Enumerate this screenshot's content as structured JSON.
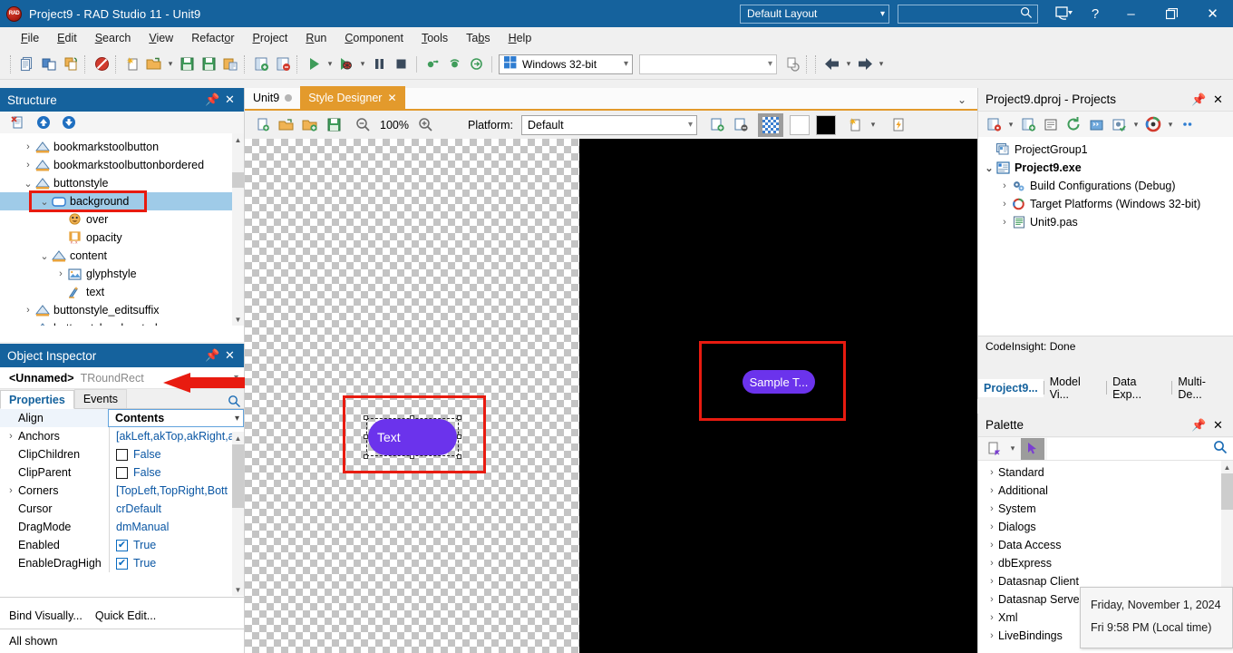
{
  "titlebar": {
    "logo": "rad-logo",
    "title": "Project9 - RAD Studio 11 - Unit9",
    "layout_value": "Default Layout",
    "search_value": "",
    "search_placeholder": "",
    "desktop_icon": "desktop-save-icon",
    "help_label": "?",
    "minimize_label": "–",
    "restore_label": "❐",
    "close_label": "✕",
    "bg_color": "#15629d"
  },
  "menubar": {
    "items": [
      {
        "pre": "",
        "accel": "F",
        "post": "ile"
      },
      {
        "pre": "",
        "accel": "E",
        "post": "dit"
      },
      {
        "pre": "",
        "accel": "S",
        "post": "earch"
      },
      {
        "pre": "",
        "accel": "V",
        "post": "iew"
      },
      {
        "pre": "Refact",
        "accel": "o",
        "post": "r"
      },
      {
        "pre": "",
        "accel": "P",
        "post": "roject"
      },
      {
        "pre": "",
        "accel": "R",
        "post": "un"
      },
      {
        "pre": "",
        "accel": "C",
        "post": "omponent"
      },
      {
        "pre": "",
        "accel": "T",
        "post": "ools"
      },
      {
        "pre": "Ta",
        "accel": "b",
        "post": "s"
      },
      {
        "pre": "",
        "accel": "H",
        "post": "elp"
      }
    ]
  },
  "toolbar": {
    "platform_value": "Windows 32-bit",
    "platform_icon": "windows-icon",
    "combo_value": "",
    "icons": [
      "new-file-icon",
      "copy-window-icon",
      "save-all-copy-icon",
      "no-entry-icon",
      "new-item-icon",
      "open-folder-icon",
      "save-icon",
      "save-as-icon",
      "save-project-icon",
      "add-file-icon",
      "remove-file-icon",
      "run-icon",
      "run-debug-icon",
      "pause-icon",
      "stop-icon",
      "trace-into-icon",
      "step-over-icon",
      "run-to-cursor-icon",
      "refresh-doc-icon",
      "nav-back-icon",
      "nav-forward-icon"
    ]
  },
  "structure": {
    "title": "Structure",
    "pin_icon": "pin-icon",
    "close_icon": "close-icon",
    "toolbar_icons": [
      "delete-node-icon",
      "move-up-icon",
      "move-down-icon"
    ],
    "tree": [
      {
        "label": "bookmarkstoolbutton",
        "indent": 1,
        "arrow": "›",
        "icon": "style-icon",
        "selected": false
      },
      {
        "label": "bookmarkstoolbuttonbordered",
        "indent": 1,
        "arrow": "›",
        "icon": "style-icon",
        "selected": false
      },
      {
        "label": "buttonstyle",
        "indent": 1,
        "arrow": "⌄",
        "icon": "style-icon",
        "selected": false
      },
      {
        "label": "background",
        "indent": 2,
        "arrow": "⌄",
        "icon": "roundrect-icon",
        "selected": true
      },
      {
        "label": "over",
        "indent": 3,
        "arrow": "",
        "icon": "brush-icon",
        "selected": false
      },
      {
        "label": "opacity",
        "indent": 3,
        "arrow": "",
        "icon": "animation-icon",
        "selected": false
      },
      {
        "label": "content",
        "indent": 2,
        "arrow": "⌄",
        "icon": "style-icon",
        "selected": false
      },
      {
        "label": "glyphstyle",
        "indent": 3,
        "arrow": "›",
        "icon": "image-icon",
        "selected": false
      },
      {
        "label": "text",
        "indent": 3,
        "arrow": "",
        "icon": "text-icon",
        "selected": false
      },
      {
        "label": "buttonstyle_editsuffix",
        "indent": 1,
        "arrow": "›",
        "icon": "style-icon",
        "selected": false
      },
      {
        "label": "buttonstyle_elevated",
        "indent": 1,
        "arrow": "›",
        "icon": "style-icon",
        "selected": false
      }
    ]
  },
  "object_inspector": {
    "title": "Object Inspector",
    "pin_icon": "pin-icon",
    "close_icon": "close-icon",
    "selected_name": "<Unnamed>",
    "selected_class": "TRoundRect",
    "tab_properties": "Properties",
    "tab_events": "Events",
    "search_icon": "search-icon",
    "filter_value": "",
    "rows": [
      {
        "name": "Align",
        "value": "Contents",
        "kind": "dropdown",
        "expandable": false
      },
      {
        "name": "Anchors",
        "value": "[akLeft,akTop,akRight,a",
        "kind": "text",
        "expandable": true
      },
      {
        "name": "ClipChildren",
        "value": "False",
        "kind": "checkbox",
        "checked": false,
        "expandable": false
      },
      {
        "name": "ClipParent",
        "value": "False",
        "kind": "checkbox",
        "checked": false,
        "expandable": false
      },
      {
        "name": "Corners",
        "value": "[TopLeft,TopRight,Bott",
        "kind": "text",
        "expandable": true
      },
      {
        "name": "Cursor",
        "value": "crDefault",
        "kind": "text",
        "expandable": false
      },
      {
        "name": "DragMode",
        "value": "dmManual",
        "kind": "text",
        "expandable": false
      },
      {
        "name": "Enabled",
        "value": "True",
        "kind": "checkbox",
        "checked": true,
        "expandable": false
      },
      {
        "name": "EnableDragHigh",
        "value": "True",
        "kind": "checkbox",
        "checked": true,
        "expandable": false
      }
    ],
    "bind_visually": "Bind Visually...",
    "quick_edit": "Quick Edit...",
    "status": "All shown"
  },
  "editor": {
    "tabs": [
      {
        "label": "Unit9",
        "active": false,
        "modified_dot": true,
        "closable": false
      },
      {
        "label": "Style Designer",
        "active": true,
        "modified_dot": false,
        "closable": true
      }
    ],
    "tab_overflow_icon": "chevron-down-icon",
    "designer_toolbar": {
      "icons": [
        "new-style-icon",
        "open-style-icon",
        "add-style-icon",
        "save-style-icon"
      ],
      "zoom_out_icon": "zoom-out-icon",
      "zoom_level": "100%",
      "zoom_in_icon": "zoom-in-icon",
      "platform_label": "Platform:",
      "platform_value": "Default",
      "right_icons": [
        "add-object-icon",
        "remove-object-icon",
        "checkerboard-bg-icon",
        "white-bg-icon",
        "black-bg-icon",
        "new-resource-icon",
        "apply-style-icon"
      ]
    },
    "canvas": {
      "left_button_label": "Text",
      "right_button_label": "Sample T...",
      "button_color": "#6b33ec",
      "highlight_color": "#e81b10",
      "preview_bg": "#000000"
    }
  },
  "projects": {
    "title": "Project9.dproj - Projects",
    "pin_icon": "pin-icon",
    "close_icon": "close-icon",
    "toolbar_icons": [
      "new-project-icon",
      "add-project-icon",
      "project-options-icon",
      "refresh-icon",
      "build-group-icon",
      "build-config-icon",
      "run-target-icon",
      "more-icon"
    ],
    "tree": [
      {
        "label": "ProjectGroup1",
        "indent": 0,
        "arrow": "",
        "icon": "project-group-icon",
        "bold": false
      },
      {
        "label": "Project9.exe",
        "indent": 0,
        "arrow": "⌄",
        "icon": "exe-icon",
        "bold": true
      },
      {
        "label": "Build Configurations (Debug)",
        "indent": 1,
        "arrow": "›",
        "icon": "gear-icon",
        "bold": false
      },
      {
        "label": "Target Platforms (Windows 32-bit)",
        "indent": 1,
        "arrow": "›",
        "icon": "target-icon",
        "bold": false
      },
      {
        "label": "Unit9.pas",
        "indent": 1,
        "arrow": "›",
        "icon": "pas-file-icon",
        "bold": false
      }
    ],
    "status": "CodeInsight: Done"
  },
  "dock_tabs": [
    {
      "label": "Project9...",
      "active": true
    },
    {
      "label": "Model Vi...",
      "active": false
    },
    {
      "label": "Data Exp...",
      "active": false
    },
    {
      "label": "Multi-De...",
      "active": false
    }
  ],
  "palette": {
    "title": "Palette",
    "pin_icon": "pin-icon",
    "close_icon": "close-icon",
    "toolbar_icons": [
      "new-component-icon",
      "chevron-down-icon",
      "pointer-tool-icon"
    ],
    "search_value": "",
    "search_icon": "search-icon",
    "categories": [
      "Standard",
      "Additional",
      "System",
      "Dialogs",
      "Data Access",
      "dbExpress",
      "Datasnap Client",
      "Datasnap Server",
      "Xml",
      "LiveBindings"
    ]
  },
  "tooltip": {
    "line1": "Friday, November 1, 2024",
    "line2": "Fri 9:58 PM (Local time)"
  }
}
